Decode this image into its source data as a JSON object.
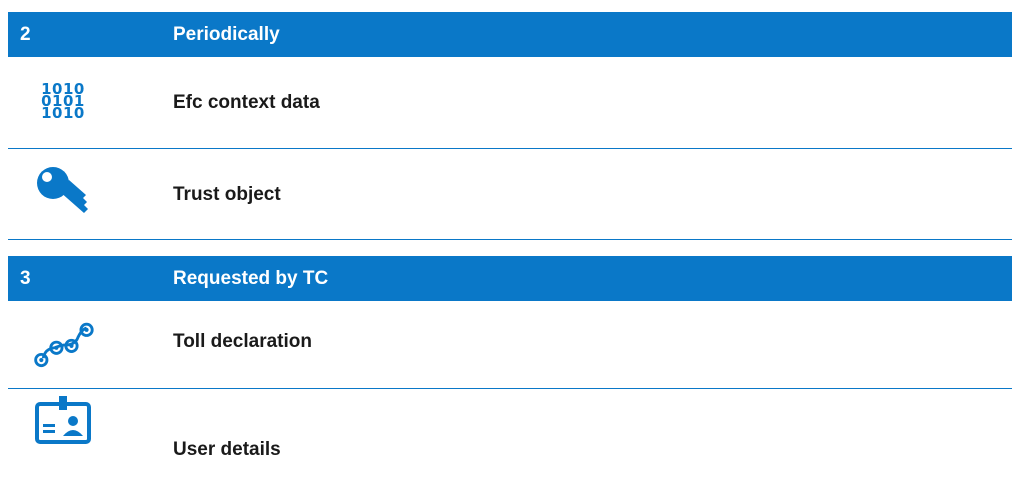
{
  "colors": {
    "accent": "#0a78c8",
    "text": "#1a1a1a",
    "background": "#ffffff"
  },
  "sections": [
    {
      "number": "2",
      "title": "Periodically",
      "items": [
        {
          "label": "Efc context data",
          "icon": "binary-data-icon",
          "icon_text": [
            "1010",
            "0101",
            "1010"
          ]
        },
        {
          "label": "Trust object",
          "icon": "key-icon"
        }
      ]
    },
    {
      "number": "3",
      "title": "Requested by TC",
      "items": [
        {
          "label": "Toll declaration",
          "icon": "route-points-icon"
        },
        {
          "label": "User details",
          "icon": "id-card-icon"
        }
      ]
    }
  ]
}
